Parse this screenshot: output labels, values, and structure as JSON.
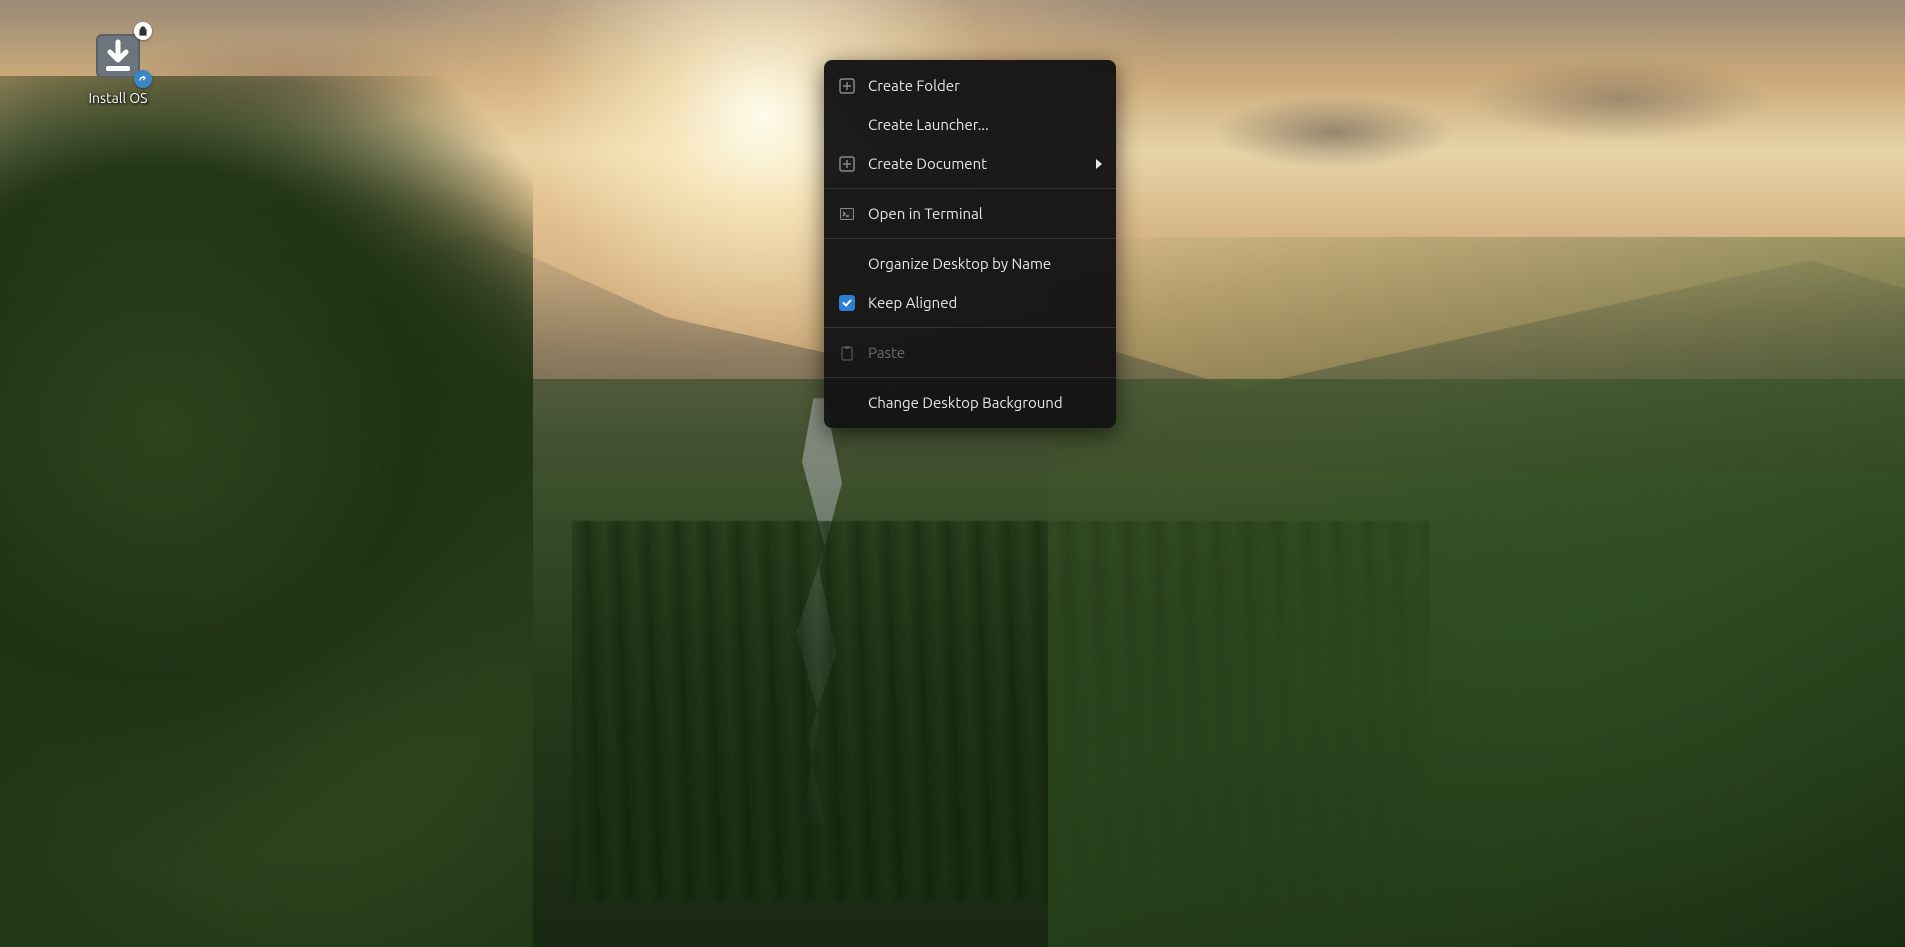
{
  "desktop": {
    "icons": [
      {
        "label": "Install OS"
      }
    ]
  },
  "context_menu": {
    "groups": [
      [
        {
          "id": "create-folder",
          "label": "Create Folder",
          "icon": "plus-box-icon",
          "enabled": true
        },
        {
          "id": "create-launcher",
          "label": "Create Launcher...",
          "icon": null,
          "enabled": true
        },
        {
          "id": "create-document",
          "label": "Create Document",
          "icon": "plus-box-icon",
          "enabled": true,
          "submenu": true
        }
      ],
      [
        {
          "id": "open-terminal",
          "label": "Open in Terminal",
          "icon": "terminal-icon",
          "enabled": true
        }
      ],
      [
        {
          "id": "organize",
          "label": "Organize Desktop by Name",
          "icon": null,
          "enabled": true
        },
        {
          "id": "keep-aligned",
          "label": "Keep Aligned",
          "icon": "checkbox-checked-icon",
          "enabled": true,
          "checked": true
        }
      ],
      [
        {
          "id": "paste",
          "label": "Paste",
          "icon": "clipboard-icon",
          "enabled": false
        }
      ],
      [
        {
          "id": "change-bg",
          "label": "Change Desktop Background",
          "icon": null,
          "enabled": true
        }
      ]
    ]
  }
}
